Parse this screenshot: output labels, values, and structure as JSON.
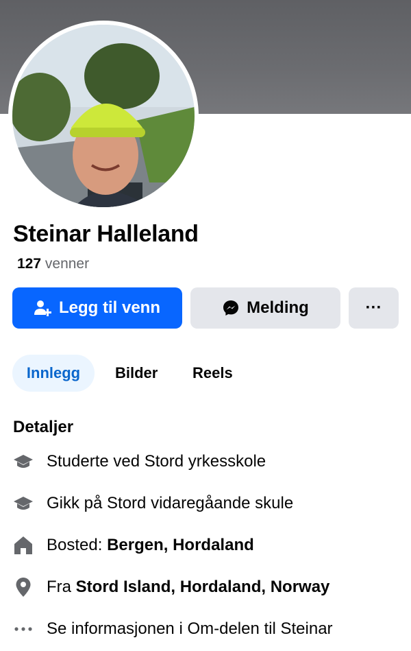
{
  "profile": {
    "name": "Steinar Halleland",
    "friends_count": "127",
    "friends_label": "venner"
  },
  "actions": {
    "add_friend_label": "Legg til venn",
    "message_label": "Melding",
    "more_label": "···"
  },
  "tabs": [
    {
      "label": "Innlegg",
      "active": true
    },
    {
      "label": "Bilder",
      "active": false
    },
    {
      "label": "Reels",
      "active": false
    }
  ],
  "details": {
    "title": "Detaljer",
    "items": [
      {
        "icon": "graduation-cap-icon",
        "text": "Studerte ved Stord yrkesskole",
        "bold": ""
      },
      {
        "icon": "graduation-cap-icon",
        "text": "Gikk på Stord vidaregåande skule",
        "bold": ""
      },
      {
        "icon": "home-icon",
        "text": "Bosted: ",
        "bold": "Bergen, Hordaland"
      },
      {
        "icon": "location-pin-icon",
        "text": "Fra ",
        "bold": "Stord Island, Hordaland, Norway"
      },
      {
        "icon": "more-dots-icon",
        "text": "Se informasjonen i Om-delen til Steinar",
        "bold": ""
      }
    ]
  },
  "colors": {
    "primary": "#0866ff",
    "secondary_button": "#e4e6eb",
    "active_tab_bg": "#ebf5ff",
    "active_tab_text": "#0a66cc",
    "icon_gray": "#65676b"
  }
}
